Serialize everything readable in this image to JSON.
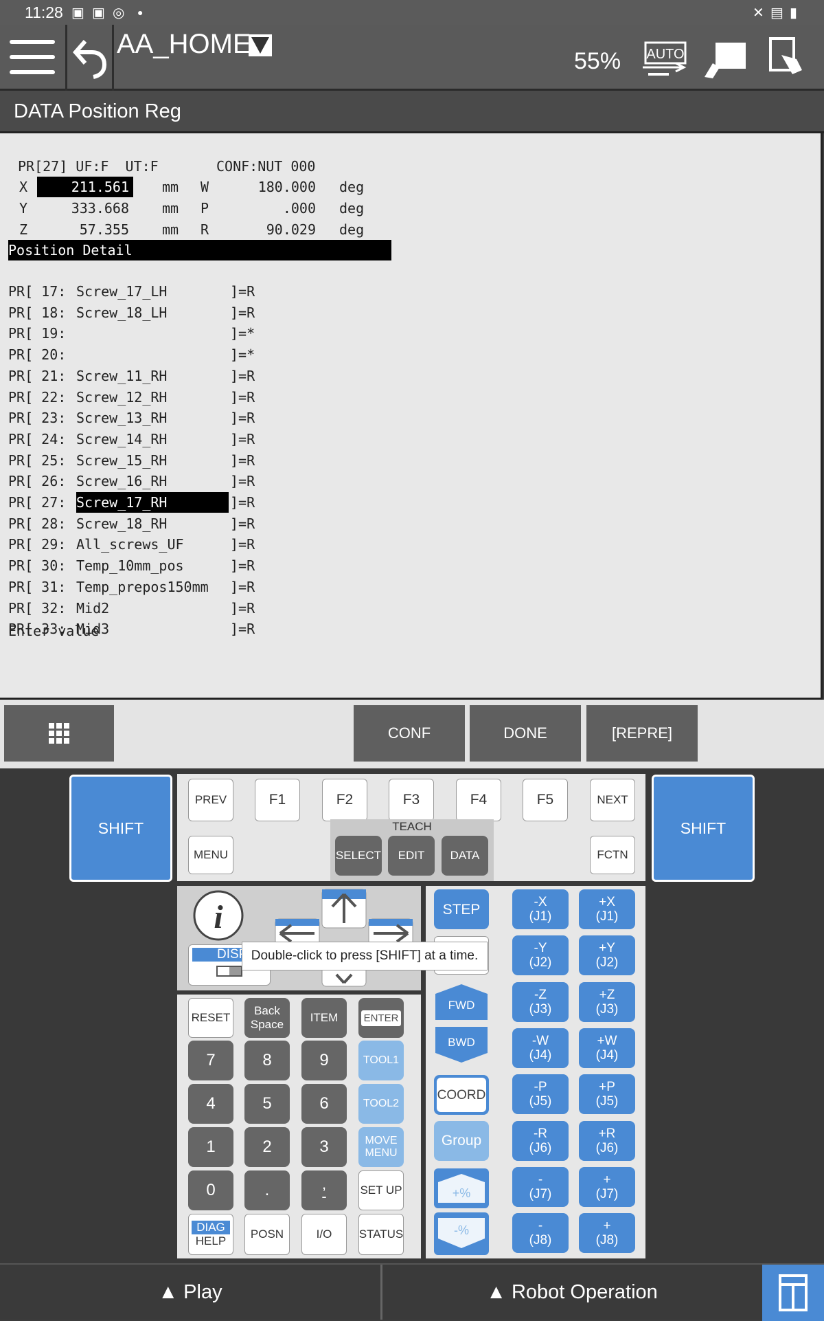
{
  "status_bar": {
    "time": "11:28"
  },
  "header": {
    "program": "AA_HOME",
    "override": "55%"
  },
  "screen": {
    "title": "DATA Position Reg",
    "pos_header": "PR[27] UF:F  UT:F       CONF:NUT 000",
    "x_label": "X",
    "x_value": "211.561",
    "x_unit": "mm",
    "w_label": "W",
    "w_value": "180.000",
    "w_unit": "deg",
    "y_label": "Y",
    "y_value": "333.668",
    "y_unit": "mm",
    "p_label": "P",
    "p_value": ".000",
    "p_unit": "deg",
    "z_label": "Z",
    "z_value": "57.355",
    "z_unit": "mm",
    "r_label": "R",
    "r_value": "90.029",
    "r_unit": "deg",
    "section": "Position Detail",
    "list": [
      {
        "pre": "PR[ 17:",
        "name": "Screw_17_LH      ",
        "post": "]=R"
      },
      {
        "pre": "PR[ 18:",
        "name": "Screw_18_LH      ",
        "post": "]=R"
      },
      {
        "pre": "PR[ 19:",
        "name": "                 ",
        "post": "]=*"
      },
      {
        "pre": "PR[ 20:",
        "name": "                 ",
        "post": "]=*"
      },
      {
        "pre": "PR[ 21:",
        "name": "Screw_11_RH      ",
        "post": "]=R"
      },
      {
        "pre": "PR[ 22:",
        "name": "Screw_12_RH      ",
        "post": "]=R"
      },
      {
        "pre": "PR[ 23:",
        "name": "Screw_13_RH      ",
        "post": "]=R"
      },
      {
        "pre": "PR[ 24:",
        "name": "Screw_14_RH      ",
        "post": "]=R"
      },
      {
        "pre": "PR[ 25:",
        "name": "Screw_15_RH      ",
        "post": "]=R"
      },
      {
        "pre": "PR[ 26:",
        "name": "Screw_16_RH      ",
        "post": "]=R"
      },
      {
        "pre": "PR[ 27:",
        "name": "Screw_17_RH      ",
        "post": "]=R"
      },
      {
        "pre": "PR[ 28:",
        "name": "Screw_18_RH      ",
        "post": "]=R"
      },
      {
        "pre": "PR[ 29:",
        "name": "All_screws_UF    ",
        "post": "]=R"
      },
      {
        "pre": "PR[ 30:",
        "name": "Temp_10mm_pos    ",
        "post": "]=R"
      },
      {
        "pre": "PR[ 31:",
        "name": "Temp_prepos150mm",
        "post": "]=R"
      },
      {
        "pre": "PR[ 32:",
        "name": "Mid2             ",
        "post": "]=R"
      },
      {
        "pre": "PR[ 33:",
        "name": "Mid3             ",
        "post": "]=R"
      }
    ],
    "prompt": "Enter value"
  },
  "fkeys": {
    "f3": "CONF",
    "f4": "DONE",
    "f5": "[REPRE]"
  },
  "pendant": {
    "shift": "SHIFT",
    "prev": "PREV",
    "next": "NEXT",
    "f1": "F1",
    "f2": "F2",
    "f3": "F3",
    "f4": "F4",
    "f5": "F5",
    "menu": "MENU",
    "fctn": "FCTN",
    "teach": "TEACH",
    "select": "SELECT",
    "edit": "EDIT",
    "data": "DATA",
    "disp": "DISP",
    "step": "STEP",
    "fwd": "FWD",
    "bwd": "BWD",
    "coord": "COORD",
    "group": "Group",
    "plus_pct": "+%",
    "minus_pct": "-%",
    "reset": "RESET",
    "back": "Back",
    "space": "Space",
    "item": "ITEM",
    "enter": "ENTER",
    "k7": "7",
    "k8": "8",
    "k9": "9",
    "k4": "4",
    "k5": "5",
    "k6": "6",
    "k1": "1",
    "k2": "2",
    "k3": "3",
    "k0": "0",
    "kdot": ".",
    "kcomma": ",",
    "kminus": "-",
    "tool1": "TOOL1",
    "tool2": "TOOL2",
    "move": "MOVE",
    "menu2": "MENU",
    "setup": "SET UP",
    "diag": "DIAG",
    "help": "HELP",
    "posn": "POSN",
    "io": "I/O",
    "status": "STATUS",
    "jog": [
      [
        "-X",
        "(J1)",
        "+X",
        "(J1)"
      ],
      [
        "-Y",
        "(J2)",
        "+Y",
        "(J2)"
      ],
      [
        "-Z",
        "(J3)",
        "+Z",
        "(J3)"
      ],
      [
        "-W",
        "(J4)",
        "+W",
        "(J4)"
      ],
      [
        "-P",
        "(J5)",
        "+P",
        "(J5)"
      ],
      [
        "-R",
        "(J6)",
        "+R",
        "(J6)"
      ],
      [
        "-",
        "(J7)",
        "+",
        "(J7)"
      ],
      [
        "-",
        "(J8)",
        "+",
        "(J8)"
      ]
    ],
    "tooltip": "Double-click to press [SHIFT] at a time."
  },
  "bottom": {
    "play": "▲  Play",
    "robot": "▲  Robot Operation"
  },
  "colors": {
    "accent": "#4a8ad4",
    "accent_light": "#8ab9e6",
    "dark_key": "#666666"
  }
}
